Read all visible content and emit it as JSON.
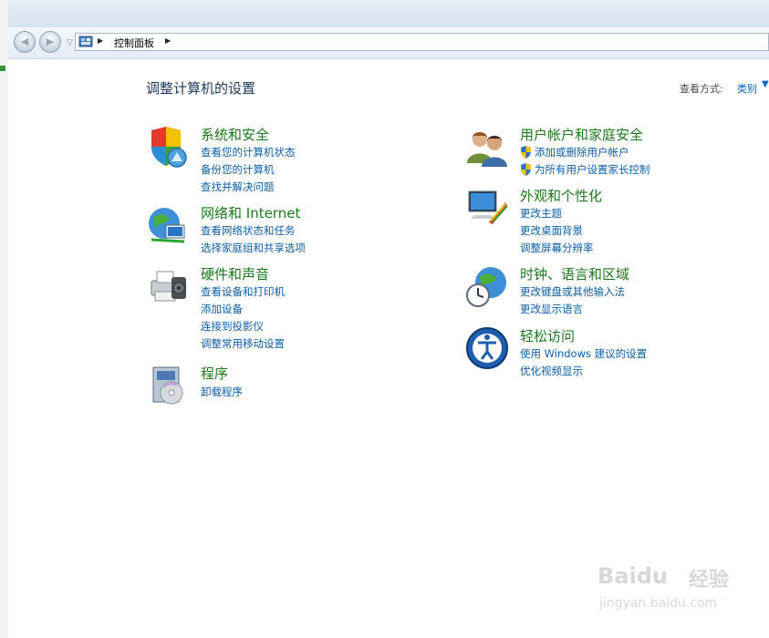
{
  "nav": {
    "breadcrumb": "控制面板"
  },
  "header": {
    "title": "调整计算机的设置",
    "view_by_label": "查看方式:",
    "view_by_value": "类别"
  },
  "categories_left": [
    {
      "title": "系统和安全",
      "links": [
        "查看您的计算机状态",
        "备份您的计算机",
        "查找并解决问题"
      ]
    },
    {
      "title": "网络和 Internet",
      "links": [
        "查看网络状态和任务",
        "选择家庭组和共享选项"
      ]
    },
    {
      "title": "硬件和声音",
      "links": [
        "查看设备和打印机",
        "添加设备",
        "连接到投影仪",
        "调整常用移动设置"
      ]
    },
    {
      "title": "程序",
      "links": [
        "卸载程序"
      ]
    }
  ],
  "categories_right": [
    {
      "title": "用户帐户和家庭安全",
      "links": [
        "添加或删除用户帐户",
        "为所有用户设置家长控制"
      ]
    },
    {
      "title": "外观和个性化",
      "links": [
        "更改主题",
        "更改桌面背景",
        "调整屏幕分辨率"
      ]
    },
    {
      "title": "时钟、语言和区域",
      "links": [
        "更改键盘或其他输入法",
        "更改显示语言"
      ]
    },
    {
      "title": "轻松访问",
      "links": [
        "使用 Windows 建议的设置",
        "优化视频显示"
      ]
    }
  ],
  "watermark": {
    "brand": "Baidu",
    "brand_cn": "经验",
    "url": "jingyan.baidu.com"
  }
}
